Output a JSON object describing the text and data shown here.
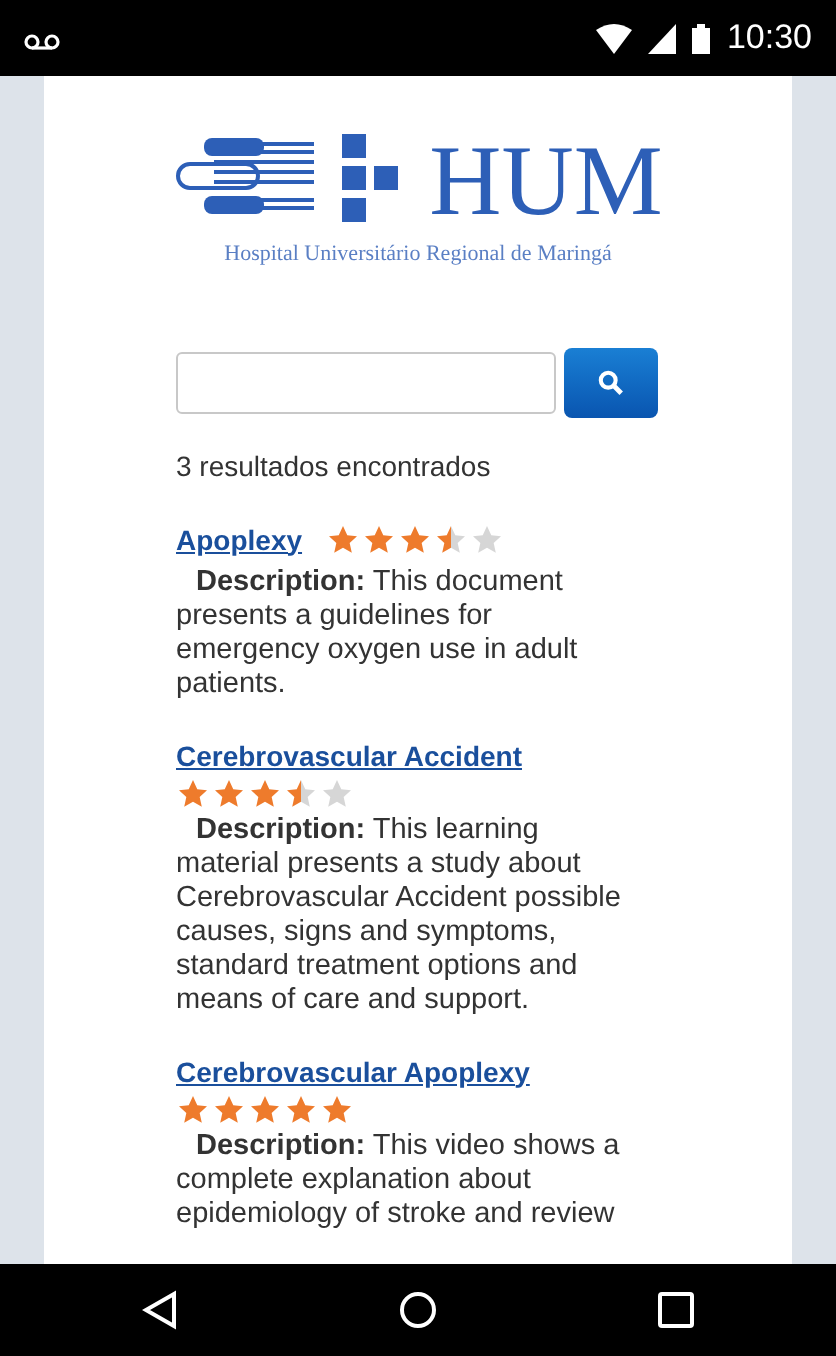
{
  "status_bar": {
    "time": "10:30"
  },
  "logo": {
    "name": "HUM",
    "subtitle": "Hospital Universitário Regional de Maringá"
  },
  "results_count": "3 resultados encontrados",
  "results": [
    {
      "title": "Apoplexy",
      "stars": 3.5,
      "description": "**Description:** This document presents a guidelines for emergency oxygen use in adult patients."
    },
    {
      "title": "Cerebrovascular Accident",
      "stars": 3.5,
      "description": "**Description:** This learning material presents a study about Cerebrovascular Accident possible causes, signs and symptoms, standard treatment options and means of care and support."
    },
    {
      "title": "Cerebrovascular Apoplexy",
      "stars": 5,
      "description": "**Description:** This video shows a complete explanation about epidemiology of stroke and review"
    }
  ]
}
